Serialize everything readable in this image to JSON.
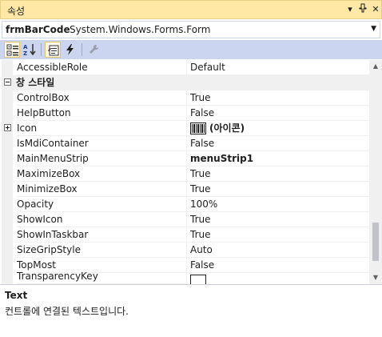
{
  "window": {
    "title": "속성",
    "dropdown_glyph": "▾",
    "pin_glyph": "⊥",
    "close_glyph": "✕"
  },
  "object_selector": {
    "name": "frmBarCode",
    "type": "System.Windows.Forms.Form"
  },
  "toolbar": {
    "buttons": [
      "categorized-icon",
      "alphabetical-icon",
      "properties-icon",
      "events-icon",
      "property-pages-icon"
    ],
    "active": [
      "categorized",
      "properties"
    ]
  },
  "grid": {
    "rows": [
      {
        "name": "AccessibleRole",
        "value": "Default"
      },
      {
        "category": "창 스타일"
      },
      {
        "name": "ControlBox",
        "value": "True"
      },
      {
        "name": "HelpButton",
        "value": "False"
      },
      {
        "name": "Icon",
        "value": "(아이콘)"
      },
      {
        "name": "IsMdiContainer",
        "value": "False"
      },
      {
        "name": "MainMenuStrip",
        "value": "menuStrip1"
      },
      {
        "name": "MaximizeBox",
        "value": "True"
      },
      {
        "name": "MinimizeBox",
        "value": "True"
      },
      {
        "name": "Opacity",
        "value": "100%"
      },
      {
        "name": "ShowIcon",
        "value": "True"
      },
      {
        "name": "ShowInTaskbar",
        "value": "True"
      },
      {
        "name": "SizeGripStyle",
        "value": "Auto"
      },
      {
        "name": "TopMost",
        "value": "False"
      },
      {
        "name": "TransparencyKey",
        "value": ""
      }
    ]
  },
  "description": {
    "title": "Text",
    "text": "컨트롤에 연결된 텍스트입니다."
  }
}
